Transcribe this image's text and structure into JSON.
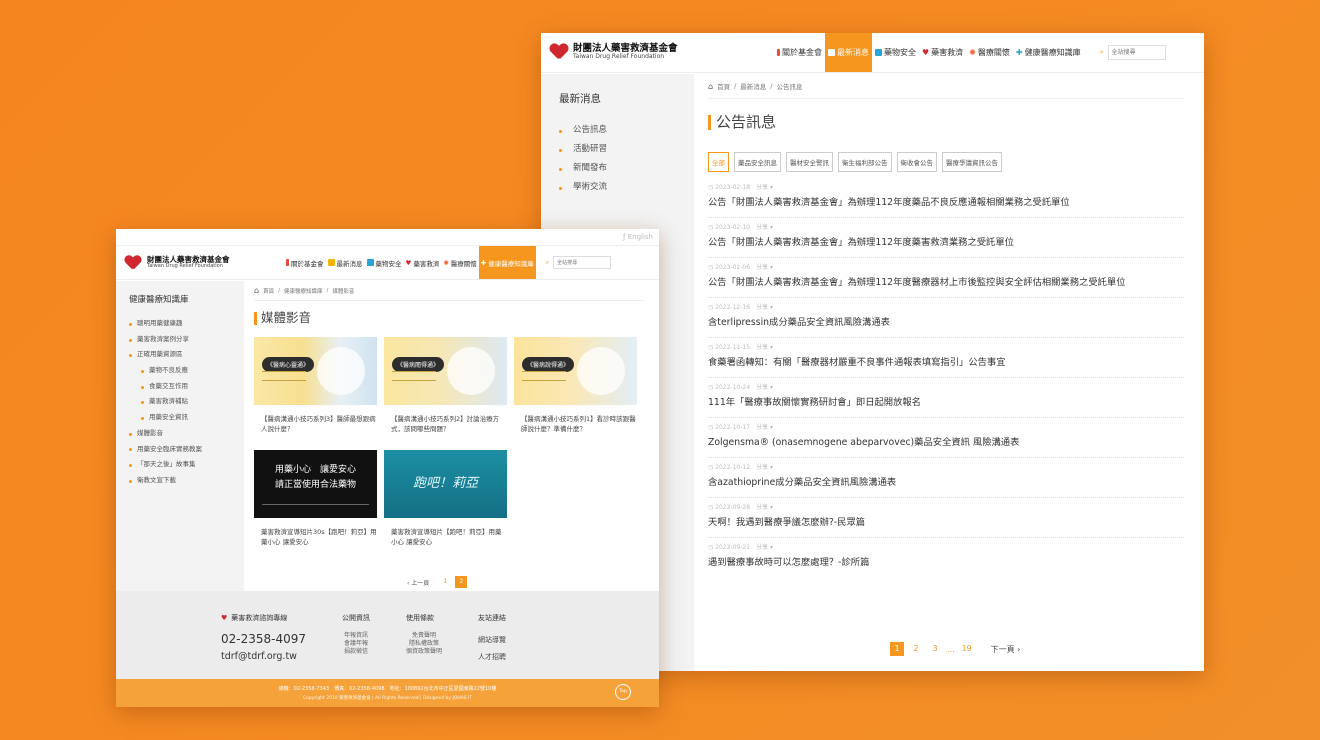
{
  "brand": {
    "name": "財團法人藥害救濟基金會",
    "subtitle": "Taiwan Drug Relief Foundation"
  },
  "nav": [
    {
      "label": "關於基金會",
      "icon": "candle-icon",
      "color": "#e74c3c"
    },
    {
      "label": "最新消息",
      "icon": "message-icon",
      "color": "#f5b400"
    },
    {
      "label": "藥物安全",
      "icon": "grid-icon",
      "color": "#27a3d6"
    },
    {
      "label": "藥害救濟",
      "icon": "heart-icon",
      "color": "#d0262e"
    },
    {
      "label": "醫療關懷",
      "icon": "flower-icon",
      "color": "#f05a28"
    },
    {
      "label": "健康醫療知識庫",
      "icon": "plus-icon",
      "color": "#27a3d6"
    }
  ],
  "search": {
    "placeholder": "全站搜尋"
  },
  "winB": {
    "sidebar": {
      "title": "最新消息",
      "items": [
        "公告訊息",
        "活動研習",
        "新聞發布",
        "學術交流"
      ]
    },
    "crumb": [
      "首頁",
      "最新消息",
      "公告訊息"
    ],
    "page_title": "公告訊息",
    "filters": [
      "全部",
      "藥品安全訊息",
      "醫材安全警訊",
      "衛生福利部公告",
      "衛收會公告",
      "醫療爭議資訊公告"
    ],
    "share": "分享",
    "news": [
      {
        "date": "2023-02-18",
        "title": "公告「財團法人藥害救濟基金會」為辦理112年度藥品不良反應通報相關業務之受託單位"
      },
      {
        "date": "2023-02-10",
        "title": "公告「財團法人藥害救濟基金會」為辦理112年度藥害救濟業務之受託單位"
      },
      {
        "date": "2023-02-06",
        "title": "公告「財團法人藥害救濟基金會」為辦理112年度醫療器材上市後監控與安全評估相關業務之受託單位"
      },
      {
        "date": "2022-12-16",
        "title": "含terlipressin成分藥品安全資訊風險溝通表"
      },
      {
        "date": "2022-11-15",
        "title": "食藥署函轉知：有關「醫療器材嚴重不良事件通報表填寫指引」公告事宜"
      },
      {
        "date": "2022-10-24",
        "title": "111年「醫療事故關懷實務研討會」即日起開放報名"
      },
      {
        "date": "2022-10-17",
        "title": "Zolgensma® (onasemnogene abeparvovec)藥品安全資訊 風險溝通表"
      },
      {
        "date": "2022-10-12",
        "title": "含azathioprine成分藥品安全資訊風險溝通表"
      },
      {
        "date": "2022-09-28",
        "title": "天啊！我遇到醫療爭議怎麼辦?-民眾篇"
      },
      {
        "date": "2022-09-21",
        "title": "遇到醫療事故時可以怎麼處理？-診所篇"
      }
    ],
    "pager": {
      "pages": [
        "1",
        "2",
        "3"
      ],
      "ellipsis": "...",
      "last": "19",
      "next": "下一頁 ›"
    }
  },
  "winA": {
    "topbar": "English",
    "sidebar": {
      "title": "健康醫療知識庫",
      "items": [
        {
          "label": "聰明用藥健康趣",
          "sub": false
        },
        {
          "label": "藥害救濟案例分享",
          "sub": false
        },
        {
          "label": "正確用藥資源區",
          "sub": false
        },
        {
          "label": "藥物不良反應",
          "sub": true
        },
        {
          "label": "食藥交互作用",
          "sub": true
        },
        {
          "label": "藥害救濟補貼",
          "sub": true
        },
        {
          "label": "用藥安全資訊",
          "sub": true
        },
        {
          "label": "媒體影音",
          "sub": false
        },
        {
          "label": "用藥安全臨床實務教案",
          "sub": false
        },
        {
          "label": "「那天之後」故事集",
          "sub": false
        },
        {
          "label": "衛教文宣下載",
          "sub": false
        }
      ]
    },
    "crumb": [
      "首頁",
      "健康醫療知識庫",
      "媒體影音"
    ],
    "page_title": "媒體影音",
    "cards": [
      {
        "thumb": "《醫病心靈通》",
        "title": "【醫病溝通小技巧系列3】醫師最想跟病人說什麼？"
      },
      {
        "thumb": "《醫病閱得通》",
        "title": "【醫病溝通小技巧系列2】討論治療方式，該問哪些問題？"
      },
      {
        "thumb": "《醫病說得通》",
        "title": "【醫病溝通小技巧系列1】看診時該跟醫師說什麼？準備什麼？"
      },
      {
        "thumb": "用藥小心　讓愛安心|請正當使用合法藥物",
        "title": "藥害救濟宣導短片30s【跑吧！莉亞】用藥小心 讓愛安心"
      },
      {
        "thumb": "跑吧！莉亞",
        "title": "藥害救濟宣導短片【跑吧！莉亞】用藥小心 讓愛安心"
      }
    ],
    "pager": {
      "prev": "‹ 上一頁",
      "pages": [
        "1",
        "2"
      ]
    },
    "footer": {
      "hotline_title": "藥害救濟諮詢專線",
      "phone": "02-2358-4097",
      "email": "tdrf@tdrf.org.tw",
      "cols": [
        {
          "title": "公開資訊",
          "links": [
            "年報資訊",
            "會議年報",
            "捐款徵信"
          ]
        },
        {
          "title": "使用條款",
          "links": [
            "免責聲明",
            "隱私權政策",
            "個資政策聲明"
          ]
        }
      ],
      "friends_title": "友站連結",
      "friends": [
        "網站導覽",
        "人才招聘"
      ],
      "contact": "總機：02-2358-7343　傳真：02-2358-4098　地址：100892台北市中正區愛國東路22號10樓",
      "copyright": "Copyright 2018 藥害救濟基金會 | All Rights Reserved | Designed by JOHAS IT",
      "top": "Top"
    }
  }
}
